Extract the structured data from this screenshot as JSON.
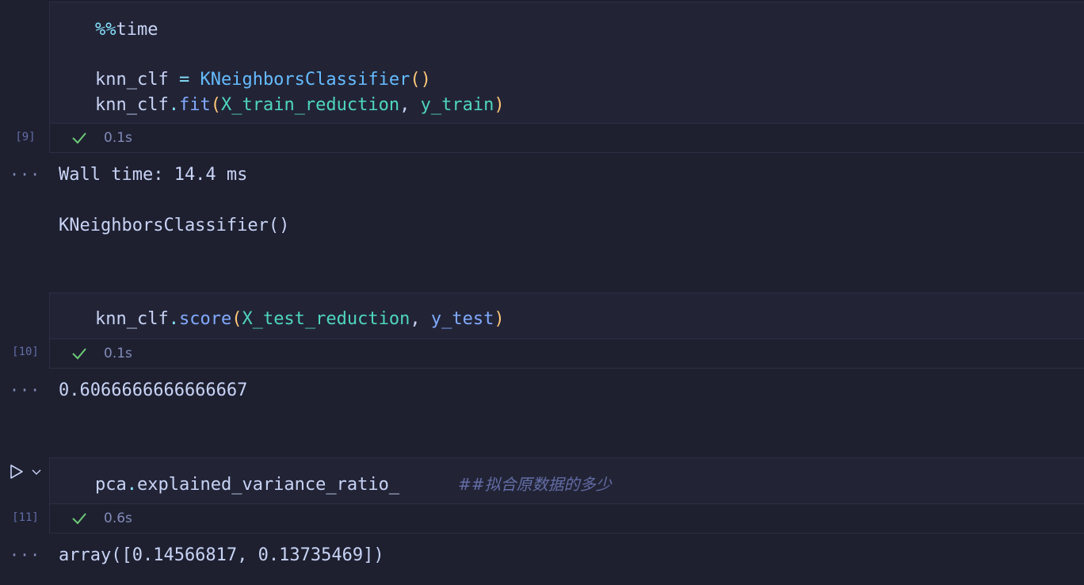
{
  "cells": [
    {
      "exec_count": "[9]",
      "duration": "0.1s",
      "code": {
        "line1": {
          "magic": "%%",
          "rest": "time"
        },
        "line2": {
          "var": "knn_clf",
          "op": " = ",
          "cls": "KNeighborsClassifier",
          "open": "(",
          "close": ")"
        },
        "line3": {
          "var": "knn_clf",
          "dot": ".",
          "fn": "fit",
          "open": "(",
          "arg1": "X_train_reduction",
          "sep": ", ",
          "arg2": "y_train",
          "close": ")"
        }
      },
      "outputs": [
        "Wall time: 14.4 ms",
        "KNeighborsClassifier()"
      ]
    },
    {
      "exec_count": "[10]",
      "duration": "0.1s",
      "code": {
        "line1": {
          "var": "knn_clf",
          "dot": ".",
          "fn": "score",
          "open": "(",
          "arg1": "X_test_reduction",
          "sep": ", ",
          "arg2": "y_test",
          "close": ")"
        }
      },
      "outputs": [
        "0.6066666666666667"
      ]
    },
    {
      "exec_count": "[11]",
      "duration": "0.6s",
      "code": {
        "line1": {
          "var": "pca",
          "dot": ".",
          "attr": "explained_variance_ratio_",
          "comment": "##拟合原数据的多少"
        }
      },
      "outputs": [
        "array([0.14566817, 0.13735469])"
      ]
    }
  ],
  "ellipsis": "···",
  "icons": {
    "status": "check-icon",
    "run": "run-cell-icon",
    "expand": "chevron-down-icon"
  },
  "colors": {
    "background": "#1e2030",
    "cell_background": "#222436",
    "check": "#6dca76"
  }
}
